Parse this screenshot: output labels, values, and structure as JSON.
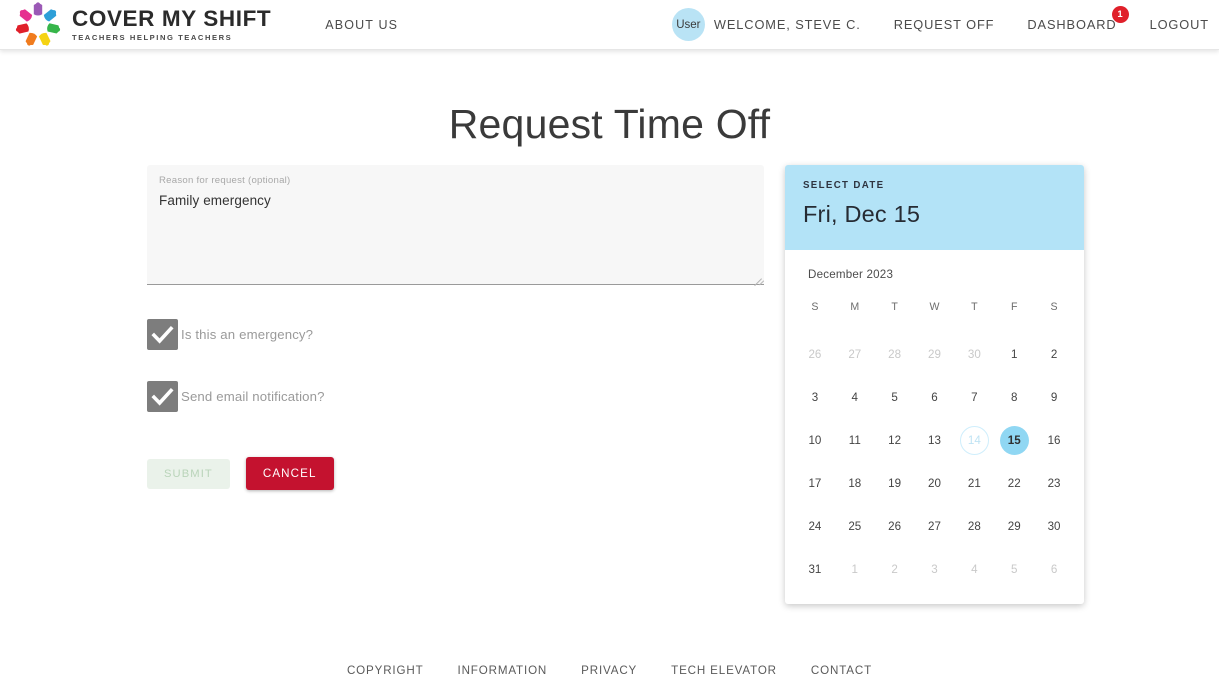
{
  "header": {
    "brand_title": "COVER MY SHIFT",
    "brand_tagline": "TEACHERS HELPING TEACHERS",
    "about_label": "ABOUT US",
    "avatar_label": "User",
    "welcome_text": "WELCOME, STEVE C.",
    "request_off_label": "REQUEST OFF",
    "dashboard_label": "DASHBOARD",
    "dashboard_badge": "1",
    "logout_label": "LOGOUT",
    "badge_color": "#e0202a",
    "avatar_color": "#b9e3f5"
  },
  "page": {
    "title": "Request Time Off"
  },
  "form": {
    "reason_label": "Reason for request (optional)",
    "reason_value": "Family emergency",
    "reason_placeholder": "Reason for request (optional)",
    "emergency_label": "Is this an emergency?",
    "emergency_checked": true,
    "email_label": "Send email notification?",
    "email_checked": true,
    "submit_label": "SUBMIT",
    "cancel_label": "CANCEL",
    "submit_color": "#eaf2ea",
    "cancel_color": "#c4122f"
  },
  "calendar": {
    "eyebrow": "SELECT DATE",
    "selected_display": "Fri, Dec 15",
    "month_label": "December 2023",
    "header_color": "#b3e3f7",
    "selected_color": "#90d7f3",
    "day_names": [
      "S",
      "M",
      "T",
      "W",
      "T",
      "F",
      "S"
    ],
    "weeks": [
      [
        {
          "d": "26",
          "state": "muted"
        },
        {
          "d": "27",
          "state": "muted"
        },
        {
          "d": "28",
          "state": "muted"
        },
        {
          "d": "29",
          "state": "muted"
        },
        {
          "d": "30",
          "state": "muted"
        },
        {
          "d": "1",
          "state": "normal"
        },
        {
          "d": "2",
          "state": "normal"
        }
      ],
      [
        {
          "d": "3",
          "state": "normal"
        },
        {
          "d": "4",
          "state": "normal"
        },
        {
          "d": "5",
          "state": "normal"
        },
        {
          "d": "6",
          "state": "normal"
        },
        {
          "d": "7",
          "state": "normal"
        },
        {
          "d": "8",
          "state": "normal"
        },
        {
          "d": "9",
          "state": "normal"
        }
      ],
      [
        {
          "d": "10",
          "state": "normal"
        },
        {
          "d": "11",
          "state": "normal"
        },
        {
          "d": "12",
          "state": "normal"
        },
        {
          "d": "13",
          "state": "normal"
        },
        {
          "d": "14",
          "state": "today"
        },
        {
          "d": "15",
          "state": "selected"
        },
        {
          "d": "16",
          "state": "normal"
        }
      ],
      [
        {
          "d": "17",
          "state": "normal"
        },
        {
          "d": "18",
          "state": "normal"
        },
        {
          "d": "19",
          "state": "normal"
        },
        {
          "d": "20",
          "state": "normal"
        },
        {
          "d": "21",
          "state": "normal"
        },
        {
          "d": "22",
          "state": "normal"
        },
        {
          "d": "23",
          "state": "normal"
        }
      ],
      [
        {
          "d": "24",
          "state": "normal"
        },
        {
          "d": "25",
          "state": "normal"
        },
        {
          "d": "26",
          "state": "normal"
        },
        {
          "d": "27",
          "state": "normal"
        },
        {
          "d": "28",
          "state": "normal"
        },
        {
          "d": "29",
          "state": "normal"
        },
        {
          "d": "30",
          "state": "normal"
        }
      ],
      [
        {
          "d": "31",
          "state": "normal"
        },
        {
          "d": "1",
          "state": "muted"
        },
        {
          "d": "2",
          "state": "muted"
        },
        {
          "d": "3",
          "state": "muted"
        },
        {
          "d": "4",
          "state": "muted"
        },
        {
          "d": "5",
          "state": "muted"
        },
        {
          "d": "6",
          "state": "muted"
        }
      ]
    ]
  },
  "footer": {
    "links": [
      "COPYRIGHT",
      "INFORMATION",
      "PRIVACY",
      "TECH ELEVATOR",
      "CONTACT"
    ]
  }
}
